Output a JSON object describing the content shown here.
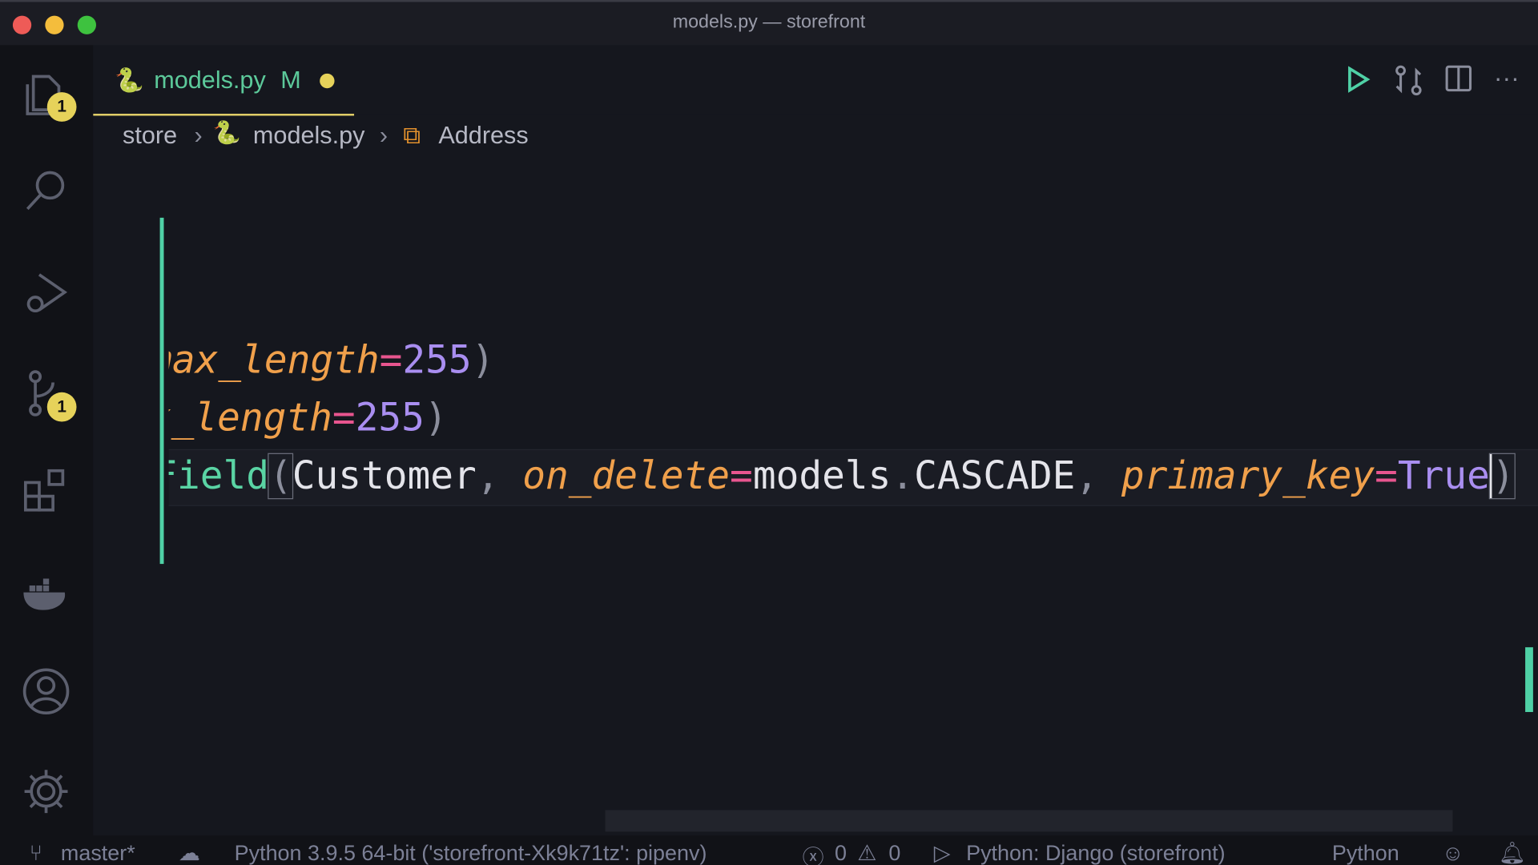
{
  "window": {
    "title": "models.py — storefront"
  },
  "activity_bar": {
    "explorer_badge": "1",
    "source_control_badge": "1"
  },
  "tab": {
    "label": "models.py",
    "status": "M"
  },
  "breadcrumb": [
    "store",
    "models.py",
    "Address"
  ],
  "code": {
    "line1": [
      "max_length",
      "=",
      "255",
      ")"
    ],
    "line2": [
      "x_length",
      "=",
      "255",
      ")"
    ],
    "line3": {
      "fn": "Field",
      "open": "(",
      "arg": "Customer",
      "comma1": ", ",
      "kw1": "on_delete",
      "eq1": "=",
      "val1a": "models",
      ".": ".",
      "val1b": "CASCADE",
      "comma2": ", ",
      "kw2": "primary_key",
      "eq2": "=",
      "val2": "True",
      "close": ")"
    }
  },
  "status_bar": {
    "branch": "master*",
    "interpreter": "Python 3.9.5 64-bit ('storefront-Xk9k71tz': pipenv)",
    "errors": "0",
    "warnings": "0",
    "debug": "Python: Django (storefront)",
    "language": "Python"
  },
  "colors": {
    "accent": "#e4d16a",
    "git_added": "#4fd1a6"
  }
}
